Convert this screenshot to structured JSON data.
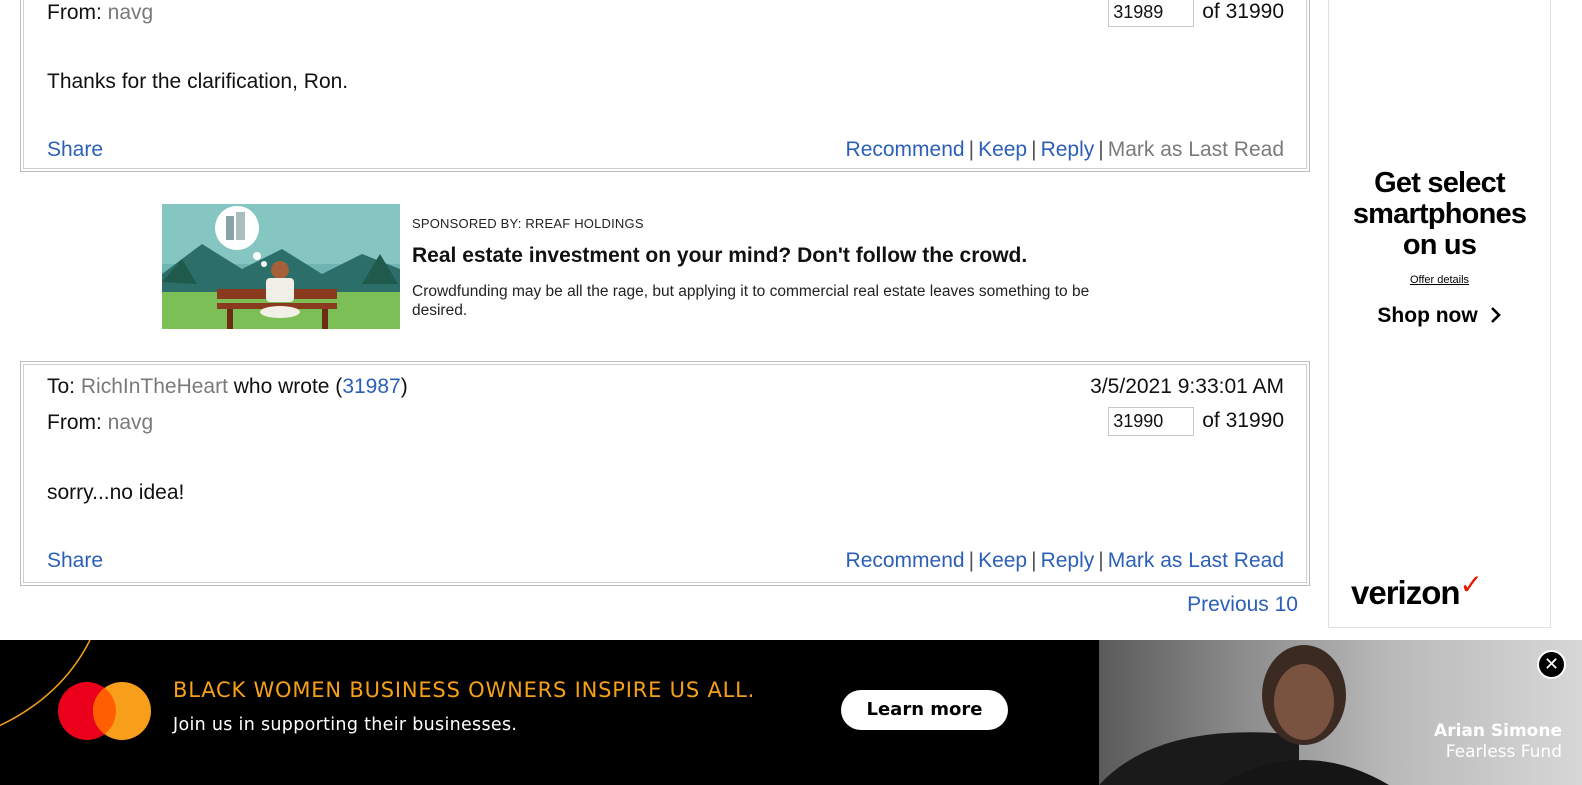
{
  "messages": [
    {
      "from_label": "From:",
      "from_user": "navg",
      "msg_number": "31989",
      "of_total": "of 31990",
      "body": "Thanks for the clarification, Ron.",
      "share": "Share",
      "actions": {
        "recommend": "Recommend",
        "keep": "Keep",
        "reply": "Reply",
        "mark_last_read": "Mark as Last Read"
      }
    },
    {
      "to_label": "To:",
      "to_user": "RichInTheHeart",
      "who_wrote": "who wrote (",
      "reply_to_number": "31987",
      "close_paren": ")",
      "date": "3/5/2021 9:33:01 AM",
      "from_label": "From:",
      "from_user": "navg",
      "msg_number": "31990",
      "of_total": "of 31990",
      "body": "sorry...no idea!",
      "share": "Share",
      "actions": {
        "recommend": "Recommend",
        "keep": "Keep",
        "reply": "Reply",
        "mark_last_read": "Mark as Last Read"
      }
    }
  ],
  "sponsored": {
    "by": "SPONSORED BY: RREAF HOLDINGS",
    "title": "Real estate investment on your mind? Don't follow the crowd.",
    "description": "Crowdfunding may be all the rage, but applying it to commercial real estate leaves something to be desired."
  },
  "pagination": {
    "previous": "Previous 10"
  },
  "side_ad": {
    "headline_1": "Get select",
    "headline_2": "smartphones",
    "headline_3": "on us",
    "offer": "Offer details",
    "cta": "Shop now",
    "brand": "verizon"
  },
  "banner_ad": {
    "headline": "BLACK WOMEN BUSINESS OWNERS INSPIRE US ALL.",
    "subline": "Join us in supporting their businesses.",
    "cta": "Learn more",
    "person_name": "Arian Simone",
    "person_org": "Fearless Fund",
    "close_symbol": "✕"
  },
  "colors": {
    "link": "#2b5fb8",
    "muted": "#7a7a7a",
    "banner_orange": "#f6a01a",
    "verizon_red": "#e11900"
  }
}
